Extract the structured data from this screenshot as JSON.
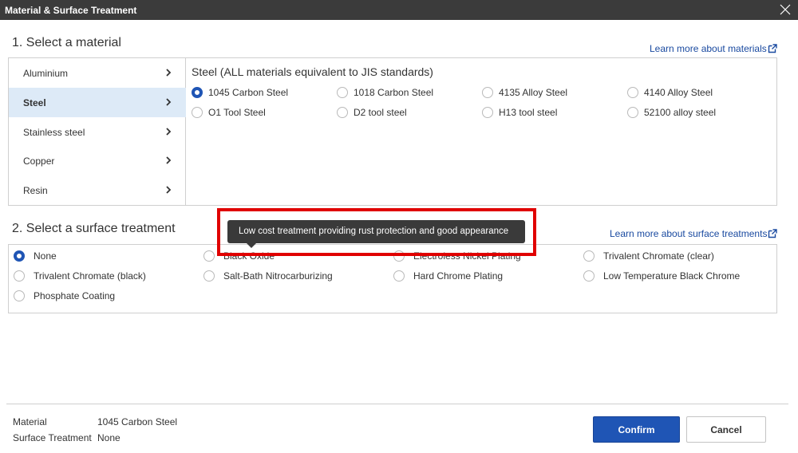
{
  "dialog": {
    "title": "Material & Surface Treatment",
    "close_icon": "close-icon"
  },
  "material": {
    "section_title": "1. Select a material",
    "learn_more": "Learn more about materials",
    "categories": [
      {
        "label": "Aluminium"
      },
      {
        "label": "Steel",
        "selected": true
      },
      {
        "label": "Stainless steel"
      },
      {
        "label": "Copper"
      },
      {
        "label": "Resin"
      }
    ],
    "group_heading": "Steel (ALL materials equivalent to JIS standards)",
    "options": [
      {
        "label": "1045 Carbon Steel",
        "checked": true
      },
      {
        "label": "1018 Carbon Steel"
      },
      {
        "label": "4135 Alloy Steel"
      },
      {
        "label": "4140 Alloy Steel"
      },
      {
        "label": "O1 Tool Steel"
      },
      {
        "label": "D2 tool steel"
      },
      {
        "label": "H13 tool steel"
      },
      {
        "label": "52100 alloy steel"
      }
    ]
  },
  "surface": {
    "section_title": "2. Select a surface treatment",
    "learn_more": "Learn more about surface treatments",
    "options": [
      {
        "label": "None",
        "checked": true
      },
      {
        "label": "Black Oxide"
      },
      {
        "label": "Electroless Nickel Plating"
      },
      {
        "label": "Trivalent Chromate (clear)"
      },
      {
        "label": "Trivalent Chromate (black)"
      },
      {
        "label": "Salt-Bath Nitrocarburizing"
      },
      {
        "label": "Hard Chrome Plating"
      },
      {
        "label": "Low Temperature Black Chrome"
      },
      {
        "label": "Phosphate Coating"
      }
    ],
    "tooltip": "Low cost treatment providing rust protection and good appearance"
  },
  "summary": {
    "material_label": "Material",
    "material_value": "1045 Carbon Steel",
    "surface_label": "Surface Treatment",
    "surface_value": "None"
  },
  "buttons": {
    "confirm": "Confirm",
    "cancel": "Cancel"
  },
  "colors": {
    "accent": "#1f55b5",
    "highlight": "#e00000",
    "selected_bg": "#ddeaf7"
  }
}
